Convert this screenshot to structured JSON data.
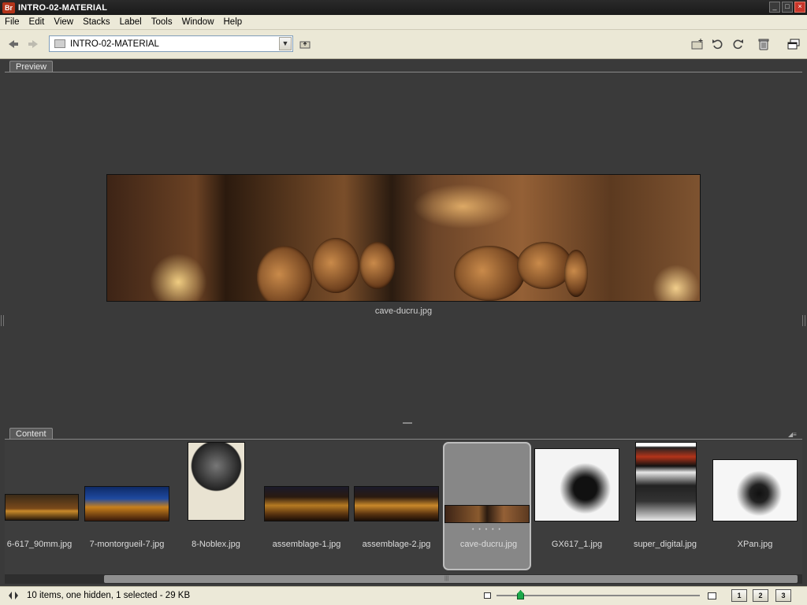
{
  "window": {
    "app_badge": "Br",
    "title": "INTRO-02-MATERIAL",
    "controls": {
      "minimize": "_",
      "maximize": "□",
      "close": "×"
    }
  },
  "menu": [
    "File",
    "Edit",
    "View",
    "Stacks",
    "Label",
    "Tools",
    "Window",
    "Help"
  ],
  "pathbar": {
    "current_folder": "INTRO-02-MATERIAL",
    "icons": [
      "back-arrow-icon",
      "forward-arrow-icon",
      "folder-icon",
      "dropdown-arrow-icon",
      "go-up-folder-icon",
      "new-folder-icon",
      "rotate-ccw-icon",
      "rotate-cw-icon",
      "trash-icon",
      "compact-mode-icon"
    ]
  },
  "preview": {
    "tab_label": "Preview",
    "caption": "cave-ducru.jpg"
  },
  "content": {
    "tab_label": "Content",
    "items": [
      {
        "name": "6-617_90mm.jpg",
        "selected": false
      },
      {
        "name": "7-montorgueil-7.jpg",
        "selected": false
      },
      {
        "name": "8-Noblex.jpg",
        "selected": false
      },
      {
        "name": "assemblage-1.jpg",
        "selected": false
      },
      {
        "name": "assemblage-2.jpg",
        "selected": false
      },
      {
        "name": "cave-ducru.jpg",
        "selected": true
      },
      {
        "name": "GX617_1.jpg",
        "selected": false
      },
      {
        "name": "super_digital.jpg",
        "selected": false
      },
      {
        "name": "XPan.jpg",
        "selected": false
      }
    ]
  },
  "status": {
    "text": "10 items, one hidden, 1 selected - 29 KB",
    "thumbnail_size": 0.12,
    "view_buttons": [
      "1",
      "2",
      "3"
    ]
  }
}
